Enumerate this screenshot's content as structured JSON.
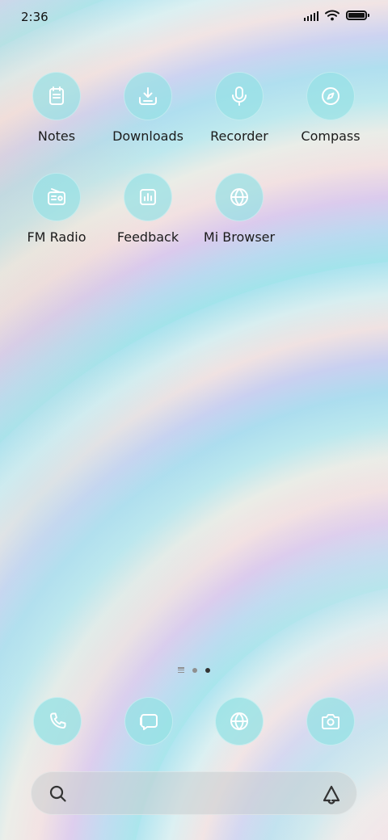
{
  "status_bar": {
    "time": "2:36",
    "icons": [
      "signal-icon",
      "wifi-icon",
      "battery-icon"
    ],
    "battery_level": 1.0
  },
  "apps": [
    {
      "label": "Notes",
      "icon": "notes-icon"
    },
    {
      "label": "Downloads",
      "icon": "download-icon"
    },
    {
      "label": "Recorder",
      "icon": "microphone-icon"
    },
    {
      "label": "Compass",
      "icon": "compass-icon"
    },
    {
      "label": "FM Radio",
      "icon": "radio-icon"
    },
    {
      "label": "Feedback",
      "icon": "feedback-chart-icon"
    },
    {
      "label": "Mi Browser",
      "icon": "globe-icon"
    }
  ],
  "page_indicator": {
    "pages": 2,
    "current_page": 2
  },
  "dock": [
    {
      "icon": "phone-icon"
    },
    {
      "icon": "messages-icon"
    },
    {
      "icon": "browser-globe-icon"
    },
    {
      "icon": "camera-icon"
    }
  ],
  "search": {
    "left_icon": "search-icon",
    "right_icon": "assistant-icon"
  },
  "colors": {
    "icon_bg": "#96e1e4",
    "label_text": "#1c1c1c",
    "search_bg": "#c8cdd0"
  }
}
